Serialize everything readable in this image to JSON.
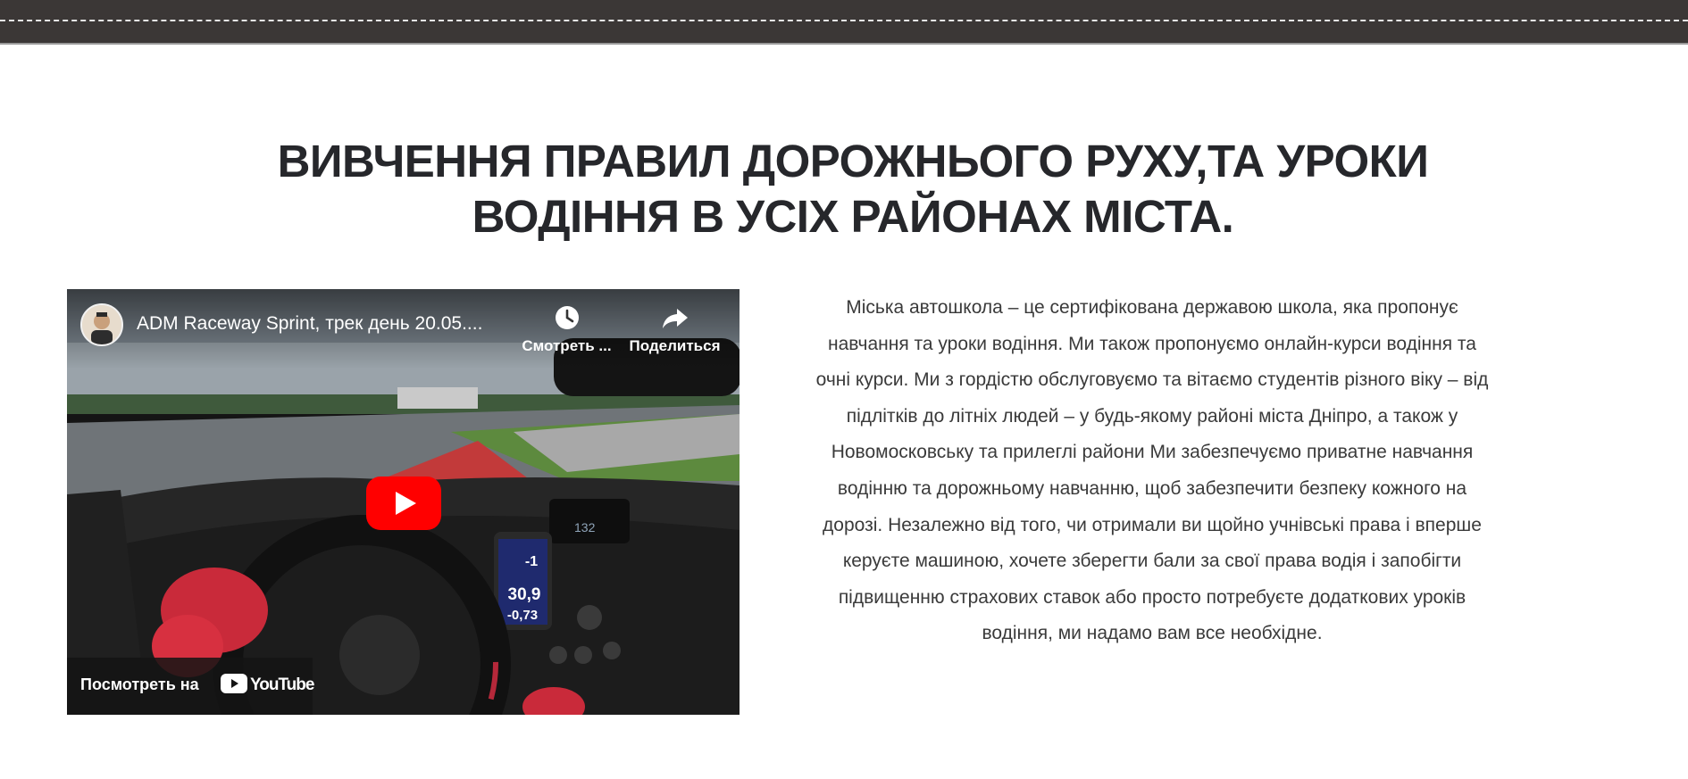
{
  "headline": {
    "line1": "ВИВЧЕННЯ ПРАВИЛ ДОРОЖНЬОГО РУХУ,ТА УРОКИ",
    "line2": "ВОДІННЯ В УСІХ РАЙОНАХ МІСТА."
  },
  "video": {
    "title": "ADM Raceway Sprint, трек день 20.05....",
    "watch_later_label": "Смотреть ...",
    "share_label": "Поделиться",
    "watch_on_label": "Посмотреть на",
    "youtube_label": "YouTube",
    "dash_readouts": [
      "-1",
      "30,9",
      "-0,73",
      "132"
    ],
    "icons": {
      "channel": "channel-avatar-icon",
      "watch_later": "clock-icon",
      "share": "share-arrow-icon",
      "play": "play-icon",
      "youtube": "youtube-logo-icon"
    }
  },
  "description": {
    "lines": [
      "Міська автошкола – це сертифікована державою школа, яка пропонує",
      "навчання та уроки водіння. Ми також пропонуємо онлайн-курси водіння та",
      "очні курси. Ми з гордістю обслуговуємо та вітаємо студентів різного віку – від",
      "підлітків до літніх людей – у будь-якому районі міста Дніпро, а також у",
      "Новомосковську та прилеглі райони Ми забезпечуємо приватне навчання",
      "водінню та дорожньому навчанню, щоб забезпечити безпеку кожного на",
      "дорозі. Незалежно від того, чи отримали ви щойно учнівські права і вперше",
      "керуєте машиною, хочете зберегти бали за свої права водія і запобігти",
      "підвищенню страхових ставок або просто потребуєте додаткових уроків",
      "водіння, ми надамо вам все необхідне."
    ]
  },
  "colors": {
    "header_bar": "#3b3736",
    "heading_text": "#26272b",
    "body_text": "#3a3a3a",
    "youtube_red": "#ff0000"
  }
}
